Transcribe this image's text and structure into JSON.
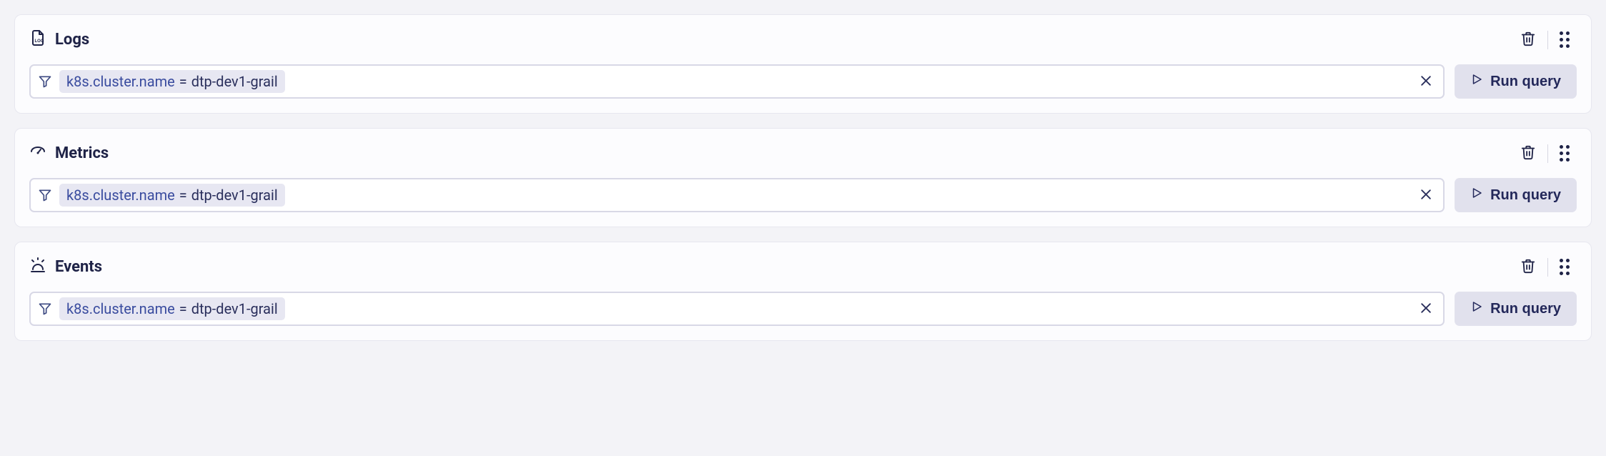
{
  "panels": [
    {
      "id": "logs",
      "title": "Logs",
      "filter": {
        "key": "k8s.cluster.name",
        "op": "=",
        "value": "dtp-dev1-grail"
      },
      "run_label": "Run query"
    },
    {
      "id": "metrics",
      "title": "Metrics",
      "filter": {
        "key": "k8s.cluster.name",
        "op": "=",
        "value": "dtp-dev1-grail"
      },
      "run_label": "Run query"
    },
    {
      "id": "events",
      "title": "Events",
      "filter": {
        "key": "k8s.cluster.name",
        "op": "=",
        "value": "dtp-dev1-grail"
      },
      "run_label": "Run query"
    }
  ]
}
